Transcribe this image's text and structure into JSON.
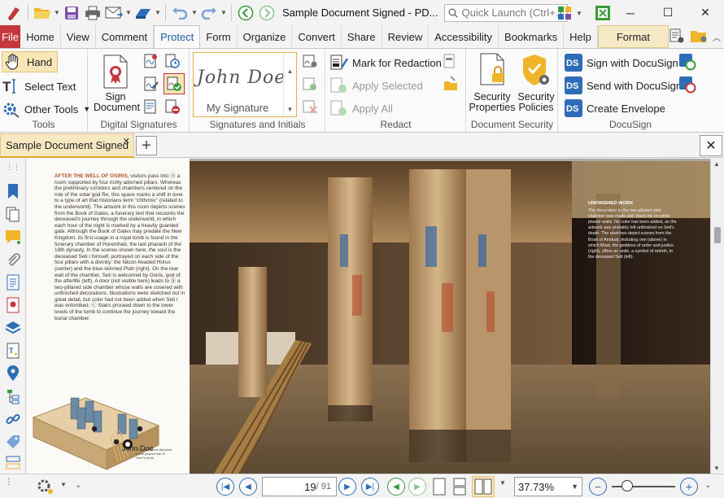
{
  "window": {
    "title": "Sample Document Signed - PD...",
    "quick_launch_placeholder": "Quick Launch (Ctrl+.)",
    "minimize": "─",
    "maximize": "☐",
    "close": "✕"
  },
  "ribbon_tabs": {
    "file": "File",
    "items": [
      "Home",
      "View",
      "Comment",
      "Protect",
      "Form",
      "Organize",
      "Convert",
      "Share",
      "Review",
      "Accessibility",
      "Bookmarks",
      "Help"
    ],
    "active": "Protect",
    "format": "Format"
  },
  "tools_group": {
    "label": "Tools",
    "hand": "Hand",
    "select_text": "Select Text",
    "other_tools": "Other Tools"
  },
  "digital_signatures_group": {
    "label": "Digital Signatures",
    "sign_document": "Sign Document"
  },
  "signatures_group": {
    "label": "Signatures and Initials",
    "signature_script": "John Doe",
    "my_signature": "My Signature"
  },
  "redact_group": {
    "label": "Redact",
    "mark_for_redaction": "Mark for Redaction",
    "apply_selected": "Apply Selected",
    "apply_all": "Apply All"
  },
  "document_security_group": {
    "label": "Document Security",
    "security_properties": "Security Properties",
    "security_policies": "Security Policies"
  },
  "docusign_group": {
    "label": "DocuSign",
    "sign_with_docusign": "Sign with DocuSign",
    "send_with_docusign": "Send with DocuSign",
    "create_envelope": "Create Envelope"
  },
  "document_tab": {
    "label": "Sample Document Signed",
    "close": "✕"
  },
  "page_content": {
    "lead": "After the well of Osiris,",
    "body": " visitors pass into ⓐ a room supported by four richly adorned pillars. Whereas the preliminary corridors and chambers centered on the role of the solar god Re, this space marks a shift in tone to a type of art that historians term \"chthonic\" (related to the underworld). The artwork in this room depicts scenes from the Book of Gates, a funerary text that recounts the deceased's journey through the underworld, in which each hour of the night is marked by a heavily guarded gate. Although the Book of Gates may predate the New Kingdom, its first usage in a royal tomb is found in the funerary chamber of Horemheb, the last pharaoh of the 18th dynasty. In the scenes shown here, the soul is the deceased Seti I himself, portrayed on each side of the four pillars with a divinity: the falcon-headed Horus (center) and the blue-skinned Ptah (right). On the rear wall of the chamber, Seti is welcomed by Osiris, god of the afterlife (left). A door (not visible here) leads to ⓑ a two-pillared side chamber whose walls are covered with unfinished decorations. Illustrations were sketched out in great detail, but color had not been added when Seti I was entombed. ⓒ Stairs proceed down to the lower levels of the tomb to continue the journey toward the burial chamber.",
    "stamp_name": "John Doe",
    "caption_title": "UNFINISHED WORK",
    "caption_body": "The decoration in the two-pillared side chamber was made with black ink on white plaster walls. No color has been added, as the artwork was probably left unfinished on Seti's death. The sketches depict scenes from the Book of Amduat, including one (above) in which Maat, the goddess of order and justice (right), offers an ankh, a symbol of rebirth, to the deceased Seti (left)."
  },
  "status_bar": {
    "current_page": "19",
    "total_pages": "/ 91",
    "zoom": "37.73%"
  },
  "colors": {
    "file_tab": "#c4373b",
    "active_tab_text": "#1f5fa6",
    "accent_gold": "#e2a82b",
    "nav_blue": "#2e6cb8"
  }
}
